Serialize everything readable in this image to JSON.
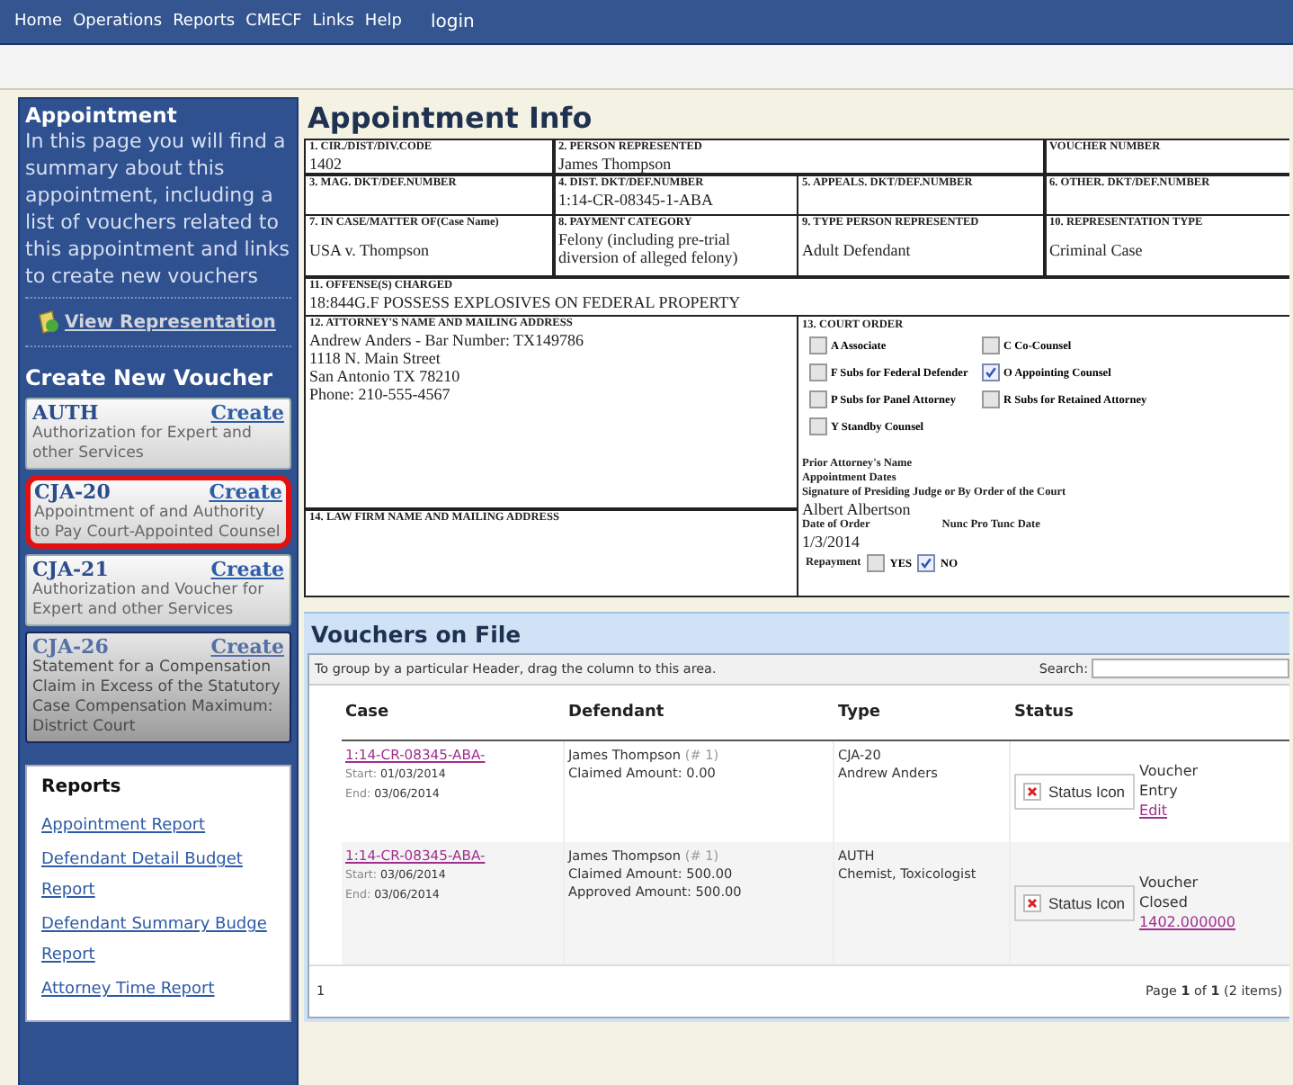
{
  "nav": {
    "items": [
      "Home",
      "Operations",
      "Reports",
      "CMECF",
      "Links",
      "Help"
    ],
    "login": "login"
  },
  "sidebar": {
    "title": "Appointment",
    "description": "In this page you will find a summary about this appointment, including a list of vouchers related to this appointment and links to create new vouchers",
    "view_link": "View Representation",
    "create_heading": "Create New Voucher",
    "vouchers": [
      {
        "code": "AUTH",
        "action": "Create",
        "description": "Authorization for Expert and other Services",
        "highlighted": false,
        "dragging": false
      },
      {
        "code": "CJA-20",
        "action": "Create",
        "description": "Appointment of and Authority to Pay Court-Appointed Counsel",
        "highlighted": true,
        "dragging": false
      },
      {
        "code": "CJA-21",
        "action": "Create",
        "description": "Authorization and Voucher for Expert and other Services",
        "highlighted": false,
        "dragging": false
      },
      {
        "code": "CJA-26",
        "action": "Create",
        "description": "Statement for a Compensation Claim in Excess of the Statutory Case Compensation Maximum: District Court",
        "highlighted": false,
        "dragging": true
      }
    ],
    "reports": {
      "title": "Reports",
      "links": [
        "Appointment Report",
        "Defendant Detail Budget Report",
        "Defendant Summary Budge Report",
        "Attorney Time Report"
      ]
    }
  },
  "form": {
    "title": "Appointment Info",
    "cells": [
      {
        "label": "1. CIR./DIST/DIV.CODE",
        "value": "1402"
      },
      {
        "label": "2. PERSON REPRESENTED",
        "value": "James Thompson"
      },
      {
        "label": "VOUCHER NUMBER"
      },
      {
        "label": "3. MAG. DKT/DEF.NUMBER"
      },
      {
        "label": "4. DIST. DKT/DEF.NUMBER",
        "value": "1:14-CR-08345-1-ABA"
      },
      {
        "label": "5. APPEALS. DKT/DEF.NUMBER"
      },
      {
        "label": "6. OTHER. DKT/DEF.NUMBER"
      },
      {
        "label": "7. IN CASE/MATTER OF(Case Name)",
        "value": "USA v. Thompson"
      },
      {
        "label": "8. PAYMENT CATEGORY",
        "value": "Felony (including pre-trial diversion of alleged felony)"
      },
      {
        "label": "9. TYPE PERSON REPRESENTED",
        "value": "Adult Defendant"
      },
      {
        "label": "10. REPRESENTATION TYPE",
        "value": "Criminal Case"
      },
      {
        "label": "11. OFFENSE(S) CHARGED",
        "value": "18:844G.F POSSESS EXPLOSIVES ON FEDERAL PROPERTY"
      },
      {
        "label": "12. ATTORNEY'S NAME AND MAILING ADDRESS",
        "value": "Andrew Anders - Bar Number: TX149786\n1118 N. Main Street\nSan Antonio TX 78210\nPhone: 210-555-4567"
      },
      {
        "label": "14. LAW FIRM NAME AND MAILING ADDRESS"
      }
    ],
    "court_order": {
      "label": "13. COURT ORDER",
      "options": [
        {
          "label": "A Associate",
          "checked": false
        },
        {
          "label": "C Co-Counsel",
          "checked": false
        },
        {
          "label": "F Subs for Federal Defender",
          "checked": false
        },
        {
          "label": "O Appointing Counsel",
          "checked": true
        },
        {
          "label": "P Subs for Panel Attorney",
          "checked": false
        },
        {
          "label": "R Subs for Retained Attorney",
          "checked": false
        },
        {
          "label": "Y Standby Counsel",
          "checked": false
        }
      ],
      "prior_attorney_label": "Prior Attorney's Name",
      "appointment_dates_label": "Appointment Dates",
      "signature_label": "Signature of Presiding Judge or By Order of the Court",
      "signature_value": "Albert Albertson",
      "date_of_order_label": "Date of Order",
      "nunc_label": "Nunc Pro Tunc Date",
      "date_value": "1/3/2014",
      "repayment_label": "Repayment",
      "repayment_options": [
        {
          "label": "YES",
          "checked": false
        },
        {
          "label": "NO",
          "checked": true
        }
      ]
    }
  },
  "vouchers": {
    "title": "Vouchers on File",
    "group_hint": "To group by a particular Header, drag the column to this area.",
    "search_label": "Search:",
    "columns": [
      "Case",
      "Defendant",
      "Type",
      "Status"
    ],
    "rows": [
      {
        "case": "1:14-CR-08345-ABA-",
        "start_label": "Start:",
        "start": "01/03/2014",
        "end_label": "End:",
        "end": "03/06/2014",
        "defendant": "James Thompson",
        "number": "(# 1)",
        "amounts": [
          "Claimed Amount: 0.00"
        ],
        "type": "CJA-20",
        "type_detail": "Andrew Anders",
        "status_icon": "Status Icon",
        "status": "Voucher Entry",
        "status_link": "Edit"
      },
      {
        "case": "1:14-CR-08345-ABA-",
        "start_label": "Start:",
        "start": "03/06/2014",
        "end_label": "End:",
        "end": "03/06/2014",
        "defendant": "James Thompson",
        "number": "(# 1)",
        "amounts": [
          "Claimed Amount: 500.00",
          "Approved Amount: 500.00"
        ],
        "type": "AUTH",
        "type_detail": "Chemist, Toxicologist",
        "status_icon": "Status Icon",
        "status": "Voucher Closed",
        "status_link": "1402.000000"
      }
    ],
    "pager": {
      "current": "1",
      "summary": "Page **1** of **1** (2 items)"
    }
  }
}
